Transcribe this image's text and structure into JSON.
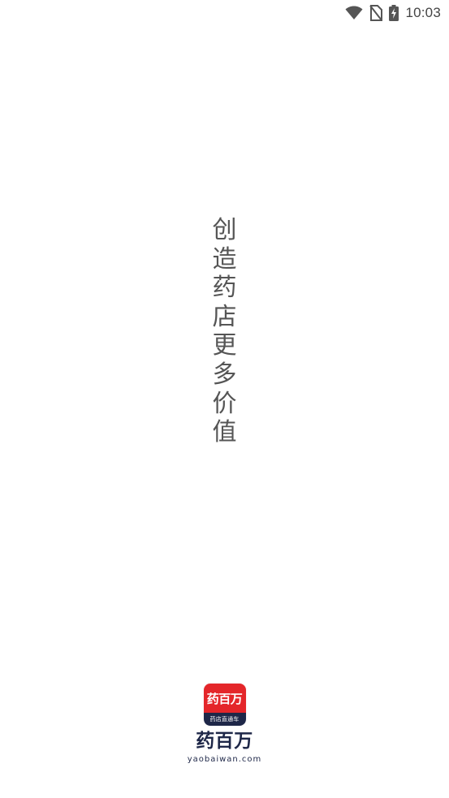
{
  "status_bar": {
    "time": "10:03",
    "icons": [
      "wifi-icon",
      "no-sim-icon",
      "battery-charging-icon"
    ]
  },
  "slogan": {
    "chars": [
      "创",
      "造",
      "药",
      "店",
      "更",
      "多",
      "价",
      "值"
    ]
  },
  "brand": {
    "logo_main_text": "药百万",
    "logo_sub_text": "药店直通车",
    "name": "药百万",
    "url": "yaobaiwan.com",
    "colors": {
      "red": "#e4262a",
      "navy": "#1e2748"
    }
  }
}
